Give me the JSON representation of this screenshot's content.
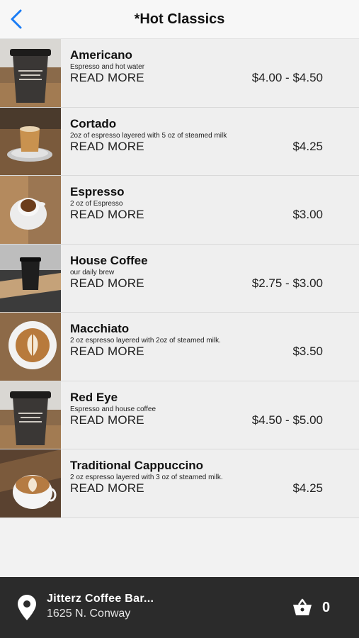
{
  "header": {
    "title": "*Hot Classics",
    "back_icon": "chevron-left-icon",
    "accent": "#1a7cf5"
  },
  "menu": {
    "read_more_label": "READ MORE",
    "items": [
      {
        "name": "Americano",
        "description": "Espresso and hot water",
        "price": "$4.00 - $4.50",
        "image": "coffee-cup-to-go"
      },
      {
        "name": "Cortado",
        "description": "2oz of espresso layered with 5 oz of steamed milk",
        "price": "$4.25",
        "image": "cortado-glass"
      },
      {
        "name": "Espresso",
        "description": "2 oz of Espresso",
        "price": "$3.00",
        "image": "espresso-cup"
      },
      {
        "name": "House Coffee",
        "description": "our daily brew",
        "price": "$2.75 - $3.00",
        "image": "house-coffee-mug"
      },
      {
        "name": "Macchiato",
        "description": "2 oz espresso layered with 2oz of steamed milk.",
        "price": "$3.50",
        "image": "macchiato-latte-art"
      },
      {
        "name": "Red Eye",
        "description": "Espresso and house coffee",
        "price": "$4.50 - $5.00",
        "image": "coffee-cup-to-go"
      },
      {
        "name": "Traditional Cappuccino",
        "description": "2 oz espresso layered with 3 oz of steamed milk.",
        "price": "$4.25",
        "image": "cappuccino-latte-art"
      }
    ]
  },
  "footer": {
    "store_name": "Jitterz Coffee Bar...",
    "store_address": "1625 N. Conway",
    "location_icon": "map-pin-icon",
    "cart_icon": "basket-icon",
    "cart_count": "0",
    "background": "#2b2b2b"
  }
}
